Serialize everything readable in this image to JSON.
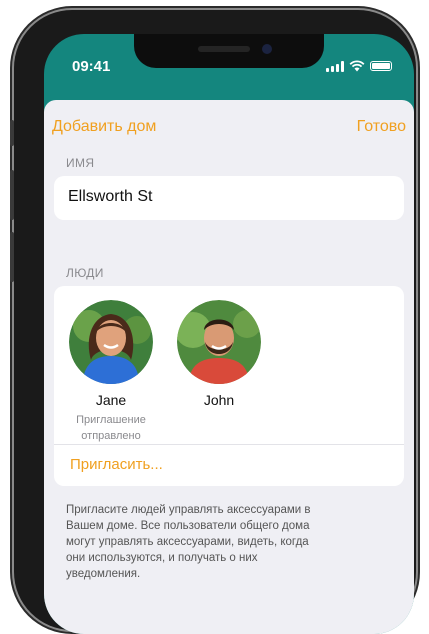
{
  "status_bar": {
    "time": "09:41"
  },
  "nav": {
    "back_label": "Добавить дом",
    "done_label": "Готово"
  },
  "name_section": {
    "label": "ИМЯ",
    "value": "Ellsworth St"
  },
  "people_section": {
    "label": "ЛЮДИ",
    "people": [
      {
        "name": "Jane",
        "status_line1": "Приглашение",
        "status_line2": "отправлено"
      },
      {
        "name": "John"
      }
    ],
    "invite_label": "Пригласить..."
  },
  "footer": {
    "line1": "Пригласите людей управлять аксессуарами в",
    "line2": "Вашем доме. Все пользователи общего дома",
    "line3": "могут управлять аксессуарами, видеть, когда",
    "line4": "они используются, и получать о них",
    "line5": "уведомления."
  },
  "colors": {
    "accent": "#f0a020",
    "wallpaper": "#14867e",
    "sheet_bg": "#efeff4"
  }
}
